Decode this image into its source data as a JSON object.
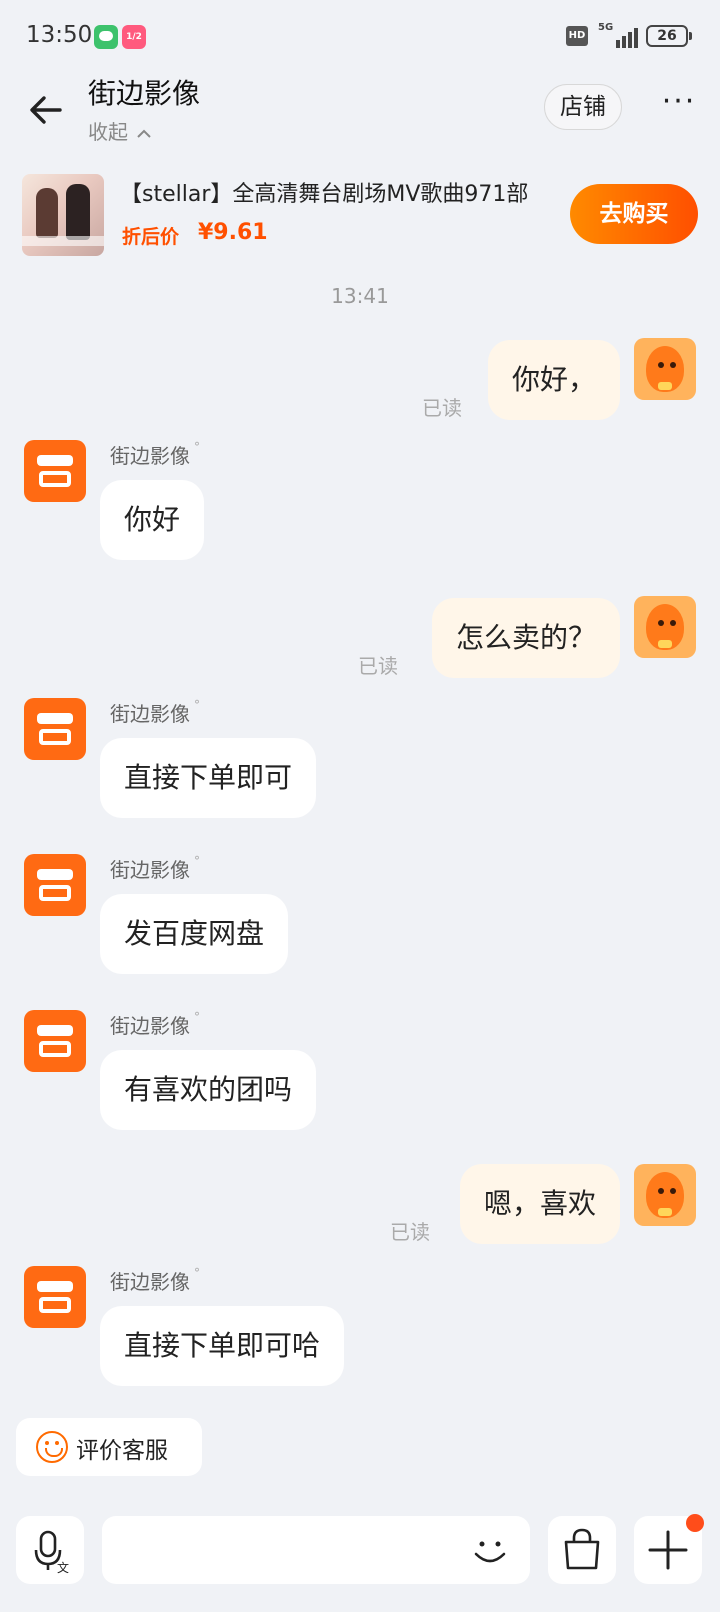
{
  "status_bar": {
    "time": "13:50",
    "battery": "26",
    "network": "5G",
    "hd": "HD",
    "app_badge": "1/2"
  },
  "header": {
    "title": "街边影像",
    "collapse_label": "收起",
    "store_label": "店铺",
    "more_label": "···"
  },
  "product": {
    "title": "【stellar】全高清舞台剧场MV歌曲971部",
    "price_label": "折后价",
    "price": "¥9.61",
    "buy_label": "去购买"
  },
  "chat": {
    "timestamp": "13:41",
    "read_label": "已读",
    "shop_name": "街边影像",
    "messages": [
      {
        "from": "me",
        "text": "你好，"
      },
      {
        "from": "shop",
        "text": "你好"
      },
      {
        "from": "me",
        "text": "怎么卖的？"
      },
      {
        "from": "shop",
        "text": "直接下单即可"
      },
      {
        "from": "shop",
        "text": "发百度网盘"
      },
      {
        "from": "shop",
        "text": "有喜欢的团吗"
      },
      {
        "from": "me",
        "text": "嗯，喜欢"
      },
      {
        "from": "shop",
        "text": "直接下单即可哈"
      }
    ]
  },
  "footer": {
    "review_label": "评价客服",
    "voice_icon": "microphone-icon",
    "emoji_icon": "smile-icon",
    "bag_icon": "shopping-bag-icon",
    "plus_icon": "plus-icon"
  },
  "colors": {
    "accent": "#ff5000",
    "my_bubble": "#fff6e9",
    "background": "#f0f2f6"
  }
}
